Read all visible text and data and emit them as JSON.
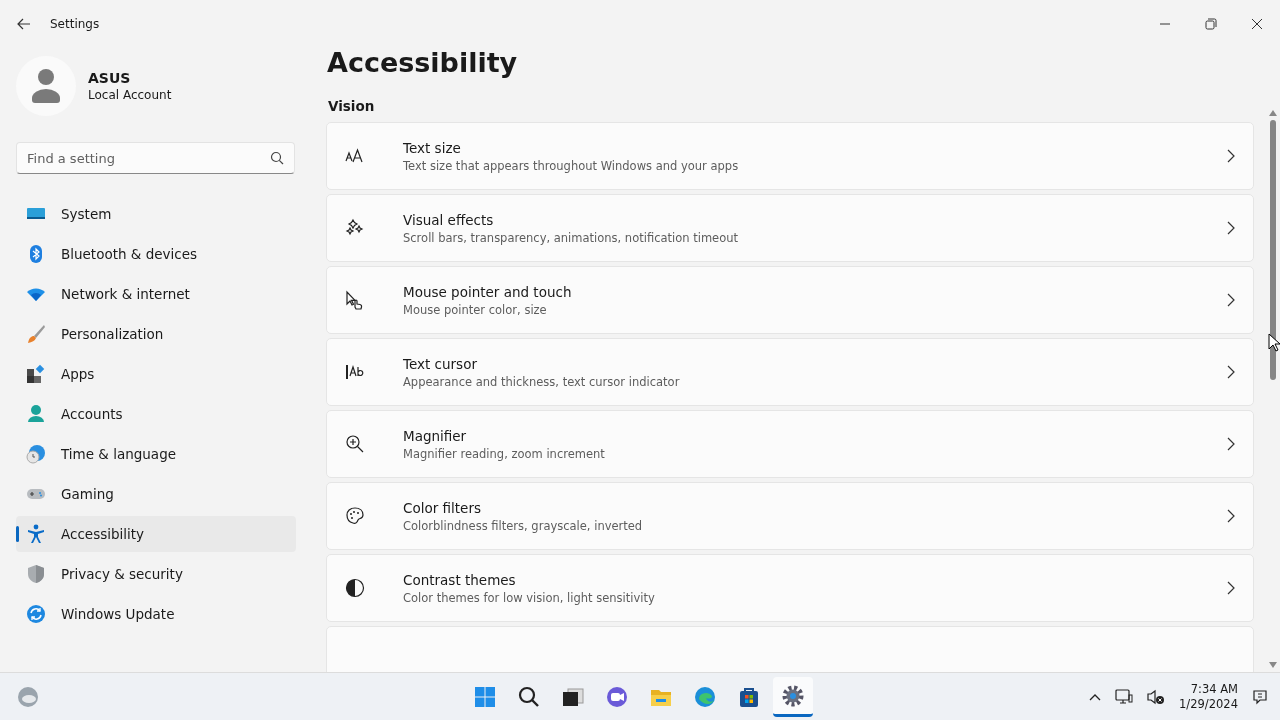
{
  "window": {
    "title": "Settings"
  },
  "account": {
    "name": "ASUS",
    "type": "Local Account"
  },
  "search": {
    "placeholder": "Find a setting"
  },
  "nav": [
    {
      "label": "System",
      "selected": false
    },
    {
      "label": "Bluetooth & devices",
      "selected": false
    },
    {
      "label": "Network & internet",
      "selected": false
    },
    {
      "label": "Personalization",
      "selected": false
    },
    {
      "label": "Apps",
      "selected": false
    },
    {
      "label": "Accounts",
      "selected": false
    },
    {
      "label": "Time & language",
      "selected": false
    },
    {
      "label": "Gaming",
      "selected": false
    },
    {
      "label": "Accessibility",
      "selected": true
    },
    {
      "label": "Privacy & security",
      "selected": false
    },
    {
      "label": "Windows Update",
      "selected": false
    }
  ],
  "page": {
    "title": "Accessibility",
    "section": "Vision",
    "items": [
      {
        "kind": "link",
        "title": "Text size",
        "subtitle": "Text size that appears throughout Windows and your apps"
      },
      {
        "kind": "link",
        "title": "Visual effects",
        "subtitle": "Scroll bars, transparency, animations, notification timeout"
      },
      {
        "kind": "link",
        "title": "Mouse pointer and touch",
        "subtitle": "Mouse pointer color, size"
      },
      {
        "kind": "link",
        "title": "Text cursor",
        "subtitle": "Appearance and thickness, text cursor indicator"
      },
      {
        "kind": "link",
        "title": "Magnifier",
        "subtitle": "Magnifier reading, zoom increment"
      },
      {
        "kind": "link",
        "title": "Color filters",
        "subtitle": "Colorblindness filters, grayscale, inverted"
      },
      {
        "kind": "link",
        "title": "Contrast themes",
        "subtitle": "Color themes for low vision, light sensitivity"
      },
      {
        "kind": "cut-off"
      }
    ]
  },
  "taskbar": {
    "apps": [
      {
        "selected": false
      },
      {
        "selected": false
      },
      {
        "selected": false
      },
      {
        "selected": false
      },
      {
        "selected": false
      },
      {
        "selected": false
      },
      {
        "selected": false
      },
      {
        "selected": true
      }
    ],
    "time": "7:34 AM",
    "date": "1/29/2024"
  }
}
